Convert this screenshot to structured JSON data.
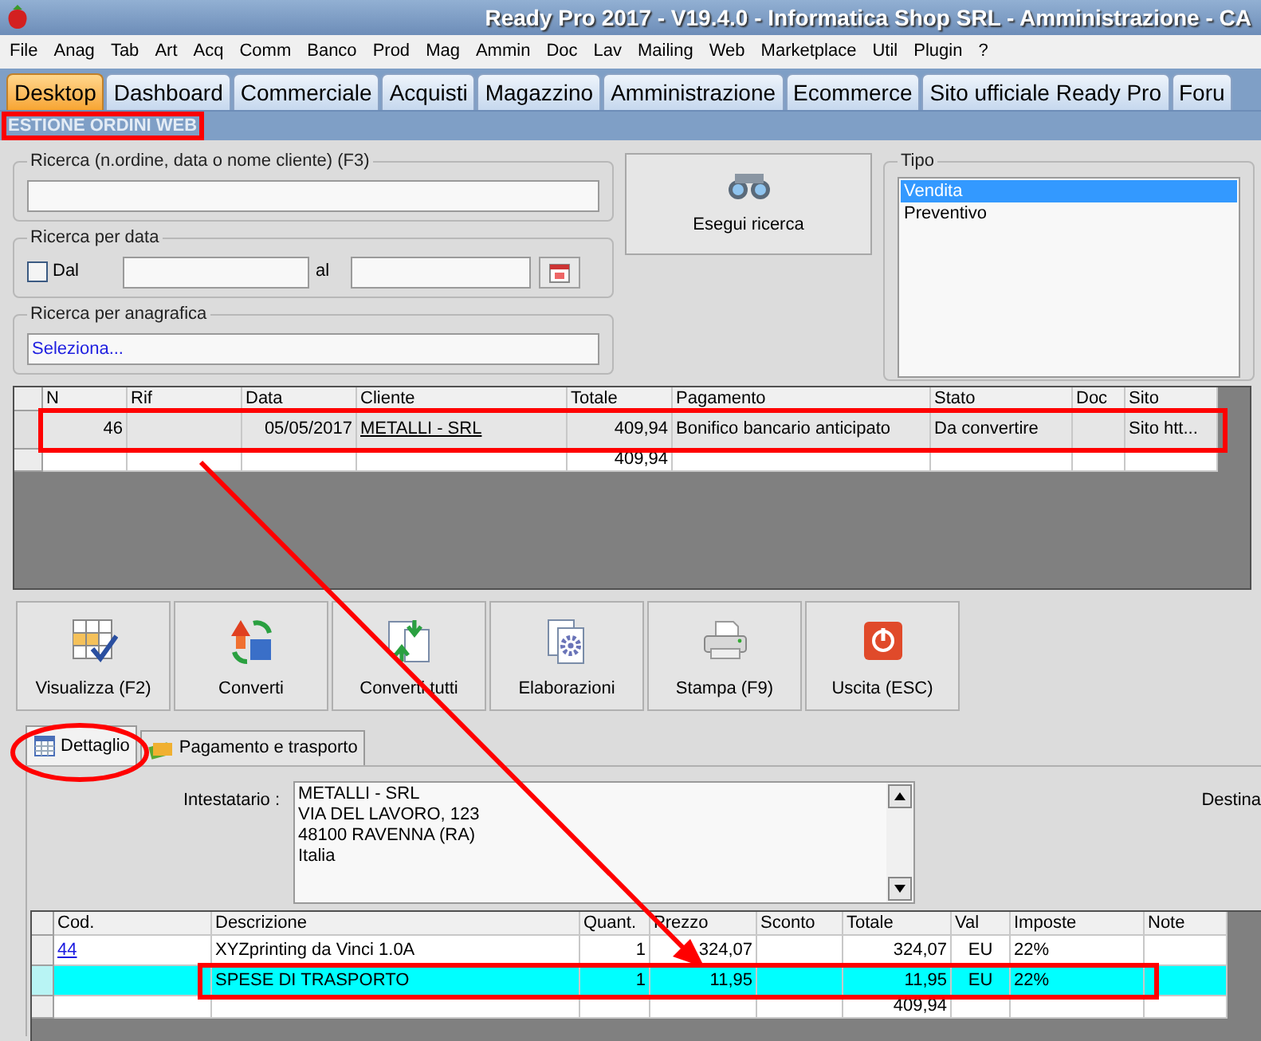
{
  "window": {
    "title": "Ready Pro 2017 - V19.4.0 - Informatica Shop SRL - Amministrazione - CA"
  },
  "menu": [
    "File",
    "Anag",
    "Tab",
    "Art",
    "Acq",
    "Comm",
    "Banco",
    "Prod",
    "Mag",
    "Ammin",
    "Doc",
    "Lav",
    "Mailing",
    "Web",
    "Marketplace",
    "Util",
    "Plugin",
    "?"
  ],
  "tabs": [
    {
      "label": "Desktop",
      "selected": true
    },
    {
      "label": "Dashboard",
      "selected": false
    },
    {
      "label": "Commerciale",
      "selected": false
    },
    {
      "label": "Acquisti",
      "selected": false
    },
    {
      "label": "Magazzino",
      "selected": false
    },
    {
      "label": "Amministrazione",
      "selected": false
    },
    {
      "label": "Ecommerce",
      "selected": false
    },
    {
      "label": "Sito ufficiale Ready Pro",
      "selected": false
    },
    {
      "label": "Foru",
      "selected": false
    }
  ],
  "section_title": "ESTIONE ORDINI WEB",
  "search": {
    "label": "Ricerca (n.ordine, data o nome cliente) (F3)"
  },
  "date_search": {
    "label": "Ricerca per data",
    "checkbox": {
      "label": "Dal",
      "checked": false
    },
    "separator": "al"
  },
  "registry_search": {
    "label": "Ricerca per anagrafica",
    "value": "Seleziona..."
  },
  "search_button": "Esegui ricerca",
  "tipo": {
    "label": "Tipo",
    "items": [
      {
        "label": "Vendita",
        "selected": true
      },
      {
        "label": "Preventivo",
        "selected": false
      }
    ]
  },
  "orders": {
    "columns": [
      "N",
      "Rif",
      "Data",
      "Cliente",
      "Totale",
      "Pagamento",
      "Stato",
      "Doc",
      "Sito"
    ],
    "rows": [
      {
        "selected": true,
        "cells": [
          "46",
          "",
          "05/05/2017",
          "METALLI - SRL",
          "409,94",
          "Bonifico bancario anticipato",
          "Da convertire",
          "",
          "Sito htt..."
        ]
      }
    ],
    "total": "409,94"
  },
  "toolbar": [
    {
      "kind": "view",
      "label": "Visualizza (F2)"
    },
    {
      "kind": "convert",
      "label": "Converti"
    },
    {
      "kind": "convert_all",
      "label": "Converti tutti"
    },
    {
      "kind": "process",
      "label": "Elaborazioni"
    },
    {
      "kind": "print",
      "label": "Stampa (F9)"
    },
    {
      "kind": "exit",
      "label": "Uscita (ESC)"
    }
  ],
  "detail_tabs": [
    {
      "label": "Dettaglio",
      "selected": true
    },
    {
      "label": "Pagamento e trasporto",
      "selected": false
    }
  ],
  "holder": {
    "label": "Intestatario :",
    "lines": [
      "METALLI - SRL",
      "VIA DEL LAVORO, 123",
      "48100 RAVENNA (RA)",
      "Italia"
    ]
  },
  "destination_label": "Destina",
  "lines": {
    "columns": [
      "Cod.",
      "Descrizione",
      "Quant.",
      "Prezzo",
      "Sconto",
      "Totale",
      "Val",
      "Imposte",
      "Note"
    ],
    "rows": [
      {
        "selected": false,
        "cells": [
          "44",
          "XYZprinting da Vinci 1.0A",
          "1",
          "324,07",
          "",
          "324,07",
          "EU",
          "22%",
          ""
        ]
      },
      {
        "selected": true,
        "cells": [
          "",
          "SPESE DI TRASPORTO",
          "1",
          "11,95",
          "",
          "11,95",
          "EU",
          "22%",
          ""
        ]
      }
    ],
    "total": "409,94"
  }
}
